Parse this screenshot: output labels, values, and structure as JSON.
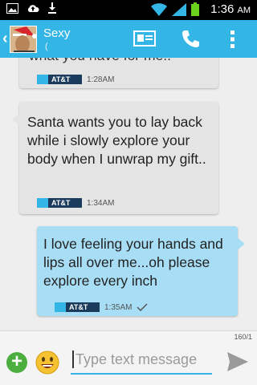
{
  "status_bar": {
    "time": "1:36",
    "ampm": "AM",
    "icons": [
      "photo-icon",
      "cloud-upload-icon",
      "download-icon",
      "wifi-icon",
      "signal-icon",
      "battery-icon"
    ]
  },
  "action_bar": {
    "contact_name": "Sexy",
    "contact_sub": "(",
    "icons": [
      "back-chevron-icon",
      "contact-card-icon",
      "phone-icon",
      "overflow-menu-icon"
    ],
    "color": "#33b5e5"
  },
  "messages": [
    {
      "direction": "incoming",
      "text": "what you have for me..",
      "carrier": "AT&T",
      "time": "1:28AM"
    },
    {
      "direction": "incoming",
      "text": "Santa wants you to lay back while i slowly explore your body when I unwrap my gift..",
      "carrier": "AT&T",
      "time": "1:34AM"
    },
    {
      "direction": "outgoing",
      "text": "I love feeling your hands and lips all over me...oh please explore every inch",
      "carrier": "AT&T",
      "time": "1:35AM",
      "status_icon": "checkmark-icon"
    }
  ],
  "compose": {
    "counter": "160/1",
    "placeholder": "Type text message",
    "icons": [
      "add-icon",
      "smiley-icon",
      "send-icon"
    ]
  }
}
